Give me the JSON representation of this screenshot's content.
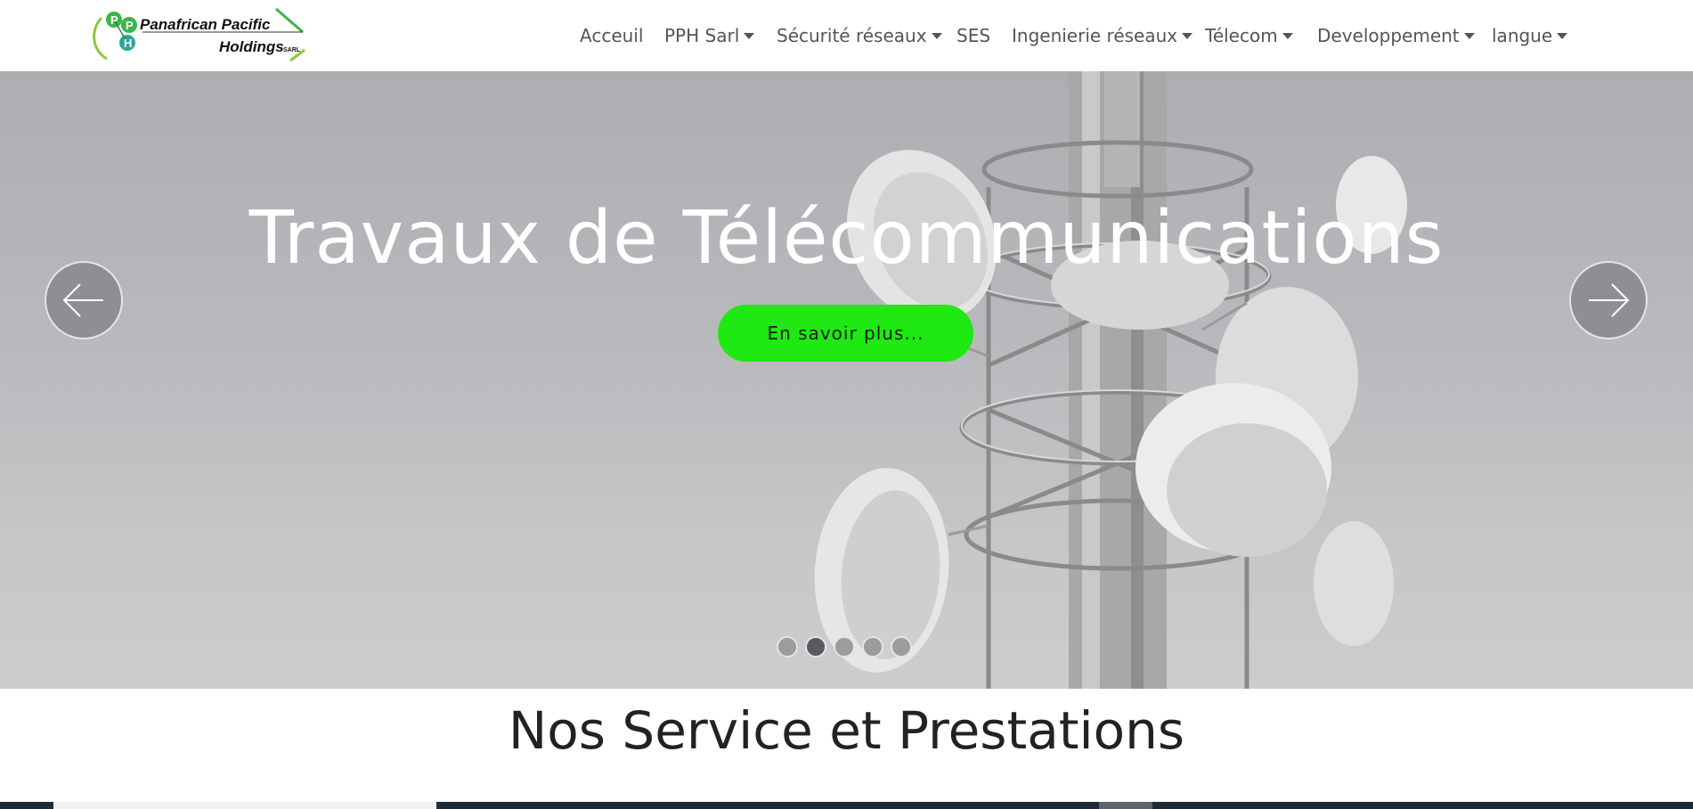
{
  "header": {
    "logo": {
      "name": "Panafrican Pacific",
      "name_line2": "Holdings",
      "suffix": "SARL",
      "letters": [
        "P",
        "P",
        "H"
      ]
    },
    "nav": [
      {
        "label": "Acceuil",
        "dropdown": false
      },
      {
        "label": "PPH Sarl",
        "dropdown": true
      },
      {
        "label": "Sécurité réseaux",
        "dropdown": true
      },
      {
        "label": "SES",
        "dropdown": false
      },
      {
        "label": "Ingenierie réseaux",
        "dropdown": true
      },
      {
        "label": "Télecom",
        "dropdown": true
      },
      {
        "label": "Developpement",
        "dropdown": true
      },
      {
        "label": "langue",
        "dropdown": true
      }
    ]
  },
  "hero": {
    "title": "Travaux de Télécommunications",
    "cta_label": "En savoir plus...",
    "cta_color": "#1fe812",
    "slides_total": 5,
    "active_slide": 2
  },
  "section": {
    "title": "Nos Service et Prestations"
  },
  "colors": {
    "nav_text": "#555555",
    "strip_dark": "#1e2c38",
    "logo_green": "#3bb54a"
  }
}
